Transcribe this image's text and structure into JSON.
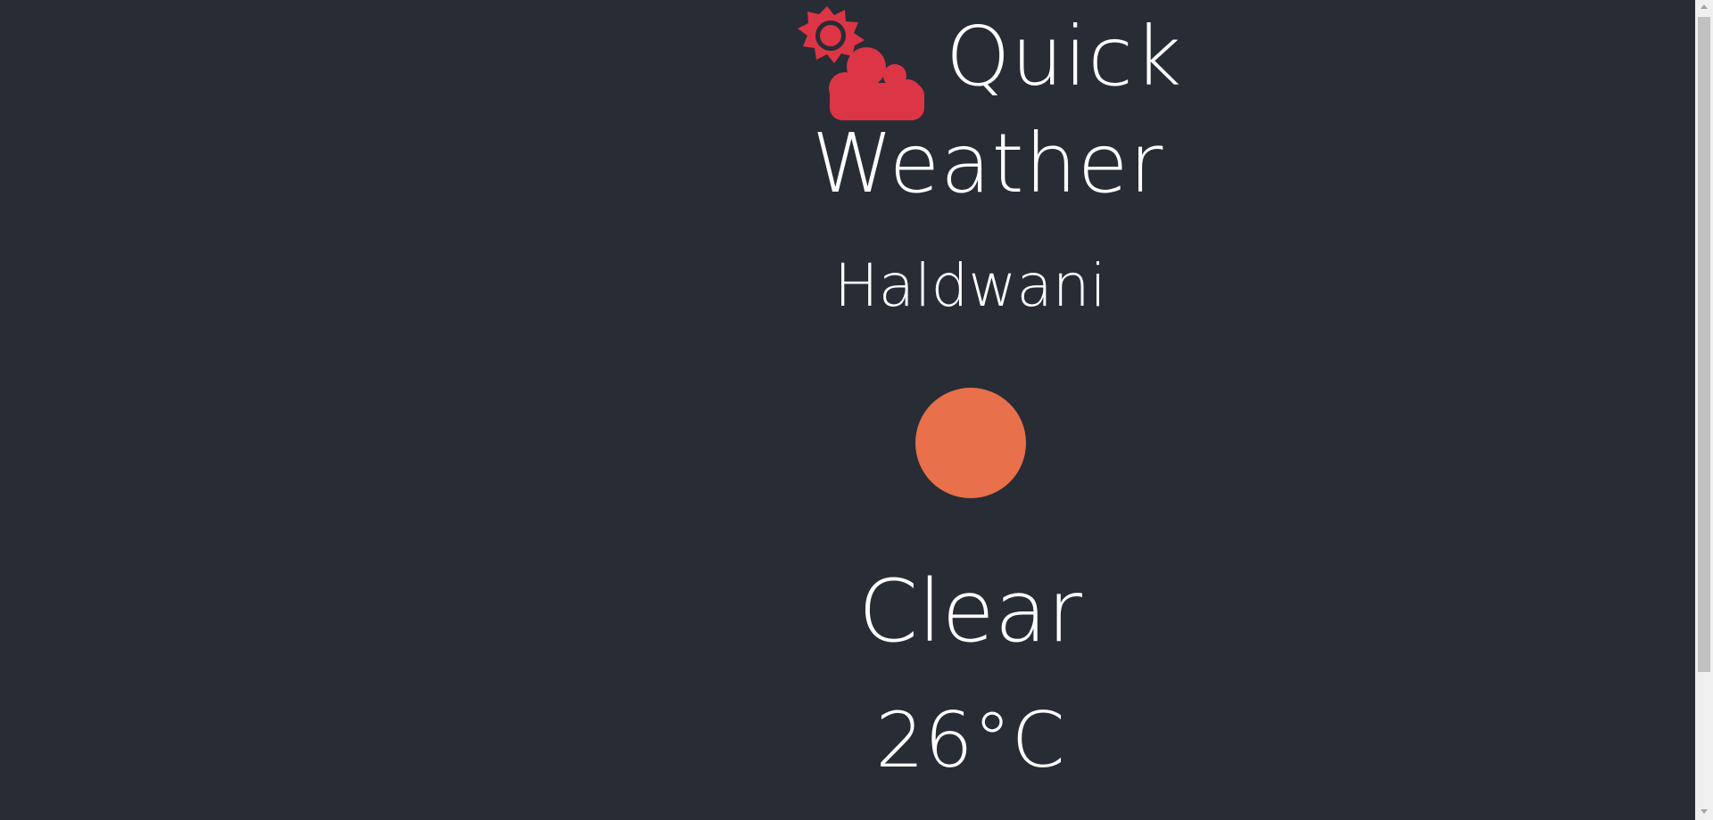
{
  "header": {
    "title_line_1": "Quick",
    "title_line_2": "Weather",
    "logo_icon": "sun-cloud-icon"
  },
  "weather": {
    "city": "Haldwani",
    "condition_icon": "sun-icon",
    "condition": "Clear",
    "temperature": "26°C"
  },
  "colors": {
    "background": "#282c35",
    "logo": "#dc3545",
    "sun": "#e8704a",
    "text": "#ffffff"
  }
}
